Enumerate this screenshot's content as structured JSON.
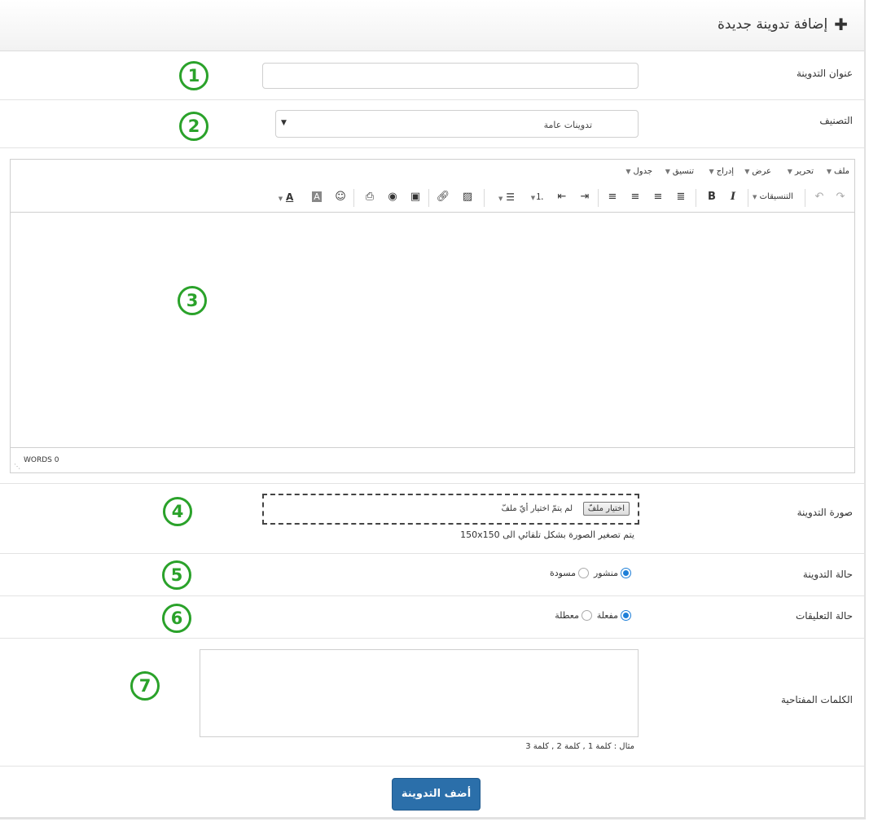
{
  "header": {
    "title": "إضافة تدوينة جديدة"
  },
  "title_field": {
    "label": "عنوان التدوينة",
    "value": "",
    "placeholder": ""
  },
  "category_field": {
    "label": "التصنيف",
    "selected": "تدوينات عامة"
  },
  "editor": {
    "menus": [
      "ملف",
      "تحرير",
      "عرض",
      "إدراج",
      "تنسيق",
      "جدول"
    ],
    "formats_label": "التنسيقات",
    "word_count": "WORDS 0",
    "content": ""
  },
  "image_field": {
    "label": "صورة التدوينة",
    "choose_button": "اختيار ملفّ",
    "no_file_text": "لم يتمّ اختيار أيّ ملفّ",
    "help_text": "يتم تصغير الصورة بشكل تلقائي الى 150x150"
  },
  "status_field": {
    "label": "حالة التدوينة",
    "options": [
      {
        "label": "منشور",
        "selected": true
      },
      {
        "label": "مسودة",
        "selected": false
      }
    ]
  },
  "comments_field": {
    "label": "حالة التعليقات",
    "options": [
      {
        "label": "مفعلة",
        "selected": true
      },
      {
        "label": "معطلة",
        "selected": false
      }
    ]
  },
  "keywords_field": {
    "label": "الكلمات المفتاحية",
    "value": "",
    "help_text": "مثال : كلمة 1 , كلمة 2 , كلمة 3"
  },
  "submit": {
    "label": "أضف التدوينة"
  },
  "annotations": [
    "1",
    "2",
    "3",
    "4",
    "5",
    "6",
    "7"
  ],
  "colors": {
    "accent": "#2b6faa",
    "annotation": "#2aa22a",
    "radio": "#1e7fd8"
  }
}
